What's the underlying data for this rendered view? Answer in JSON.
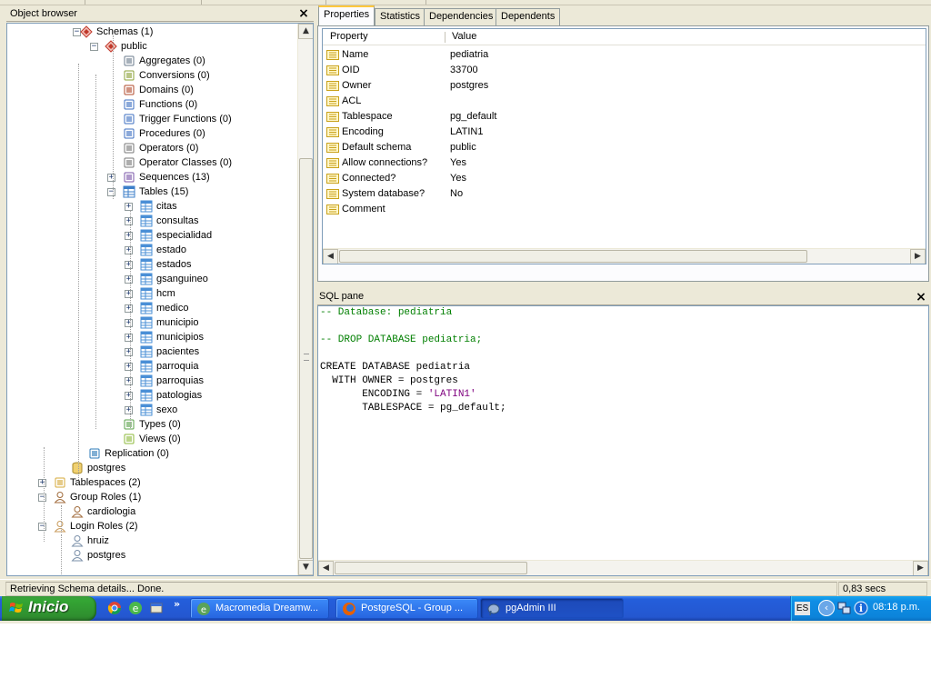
{
  "object_browser": {
    "title": "Object browser",
    "tree": [
      {
        "label": "Schemas (1)",
        "icon": "schemas-icon"
      },
      {
        "label": "public",
        "icon": "schema-icon"
      },
      {
        "label": "Aggregates (0)",
        "icon": "aggregates-icon"
      },
      {
        "label": "Conversions (0)",
        "icon": "conversions-icon"
      },
      {
        "label": "Domains (0)",
        "icon": "domains-icon"
      },
      {
        "label": "Functions (0)",
        "icon": "functions-icon"
      },
      {
        "label": "Trigger Functions (0)",
        "icon": "trigger-functions-icon"
      },
      {
        "label": "Procedures (0)",
        "icon": "procedures-icon"
      },
      {
        "label": "Operators (0)",
        "icon": "operators-icon"
      },
      {
        "label": "Operator Classes (0)",
        "icon": "operator-classes-icon"
      },
      {
        "label": "Sequences (13)",
        "icon": "sequences-icon"
      },
      {
        "label": "Tables (15)",
        "icon": "tables-icon"
      },
      {
        "label": "citas",
        "icon": "table-icon"
      },
      {
        "label": "consultas",
        "icon": "table-icon"
      },
      {
        "label": "especialidad",
        "icon": "table-icon"
      },
      {
        "label": "estado",
        "icon": "table-icon"
      },
      {
        "label": "estados",
        "icon": "table-icon"
      },
      {
        "label": "gsanguineo",
        "icon": "table-icon"
      },
      {
        "label": "hcm",
        "icon": "table-icon"
      },
      {
        "label": "medico",
        "icon": "table-icon"
      },
      {
        "label": "municipio",
        "icon": "table-icon"
      },
      {
        "label": "municipios",
        "icon": "table-icon"
      },
      {
        "label": "pacientes",
        "icon": "table-icon"
      },
      {
        "label": "parroquia",
        "icon": "table-icon"
      },
      {
        "label": "parroquias",
        "icon": "table-icon"
      },
      {
        "label": "patologias",
        "icon": "table-icon"
      },
      {
        "label": "sexo",
        "icon": "table-icon"
      },
      {
        "label": "Types (0)",
        "icon": "types-icon"
      },
      {
        "label": "Views (0)",
        "icon": "views-icon"
      },
      {
        "label": "Replication (0)",
        "icon": "replication-icon"
      },
      {
        "label": "postgres",
        "icon": "database-icon"
      },
      {
        "label": "Tablespaces (2)",
        "icon": "tablespaces-icon"
      },
      {
        "label": "Group Roles (1)",
        "icon": "group-roles-icon"
      },
      {
        "label": "cardiologia",
        "icon": "group-role-icon"
      },
      {
        "label": "Login Roles (2)",
        "icon": "login-roles-icon"
      },
      {
        "label": "hruiz",
        "icon": "login-role-icon"
      },
      {
        "label": "postgres",
        "icon": "login-role-icon"
      }
    ]
  },
  "tabs": [
    "Properties",
    "Statistics",
    "Dependencies",
    "Dependents"
  ],
  "properties": {
    "columns": [
      "Property",
      "Value"
    ],
    "rows": [
      {
        "name": "Name",
        "value": "pediatria"
      },
      {
        "name": "OID",
        "value": "33700"
      },
      {
        "name": "Owner",
        "value": "postgres"
      },
      {
        "name": "ACL",
        "value": ""
      },
      {
        "name": "Tablespace",
        "value": "pg_default"
      },
      {
        "name": "Encoding",
        "value": "LATIN1"
      },
      {
        "name": "Default schema",
        "value": "public"
      },
      {
        "name": "Allow connections?",
        "value": "Yes"
      },
      {
        "name": "Connected?",
        "value": "Yes"
      },
      {
        "name": "System database?",
        "value": "No"
      },
      {
        "name": "Comment",
        "value": ""
      }
    ]
  },
  "sql_pane": {
    "title": "SQL pane",
    "line1": "-- Database: pediatria",
    "line3": "-- DROP DATABASE pediatria;",
    "line5": "CREATE DATABASE pediatria",
    "line6": "  WITH OWNER = postgres",
    "line7_prefix": "       ENCODING = ",
    "line7_str": "'LATIN1'",
    "line8": "       TABLESPACE = pg_default;"
  },
  "statusbar": {
    "message": "Retrieving Schema details... Done.",
    "timing": "0,83 secs"
  },
  "taskbar": {
    "start_label": "Inicio",
    "more_label": "»",
    "tasks": [
      {
        "label": "Macromedia Dreamw...",
        "icon": "dreamweaver-icon"
      },
      {
        "label": "PostgreSQL - Group ...",
        "icon": "firefox-icon"
      },
      {
        "label": "pgAdmin III",
        "icon": "pgadmin-elephant-icon"
      }
    ],
    "lang": "ES",
    "time": "08:18 p.m."
  }
}
